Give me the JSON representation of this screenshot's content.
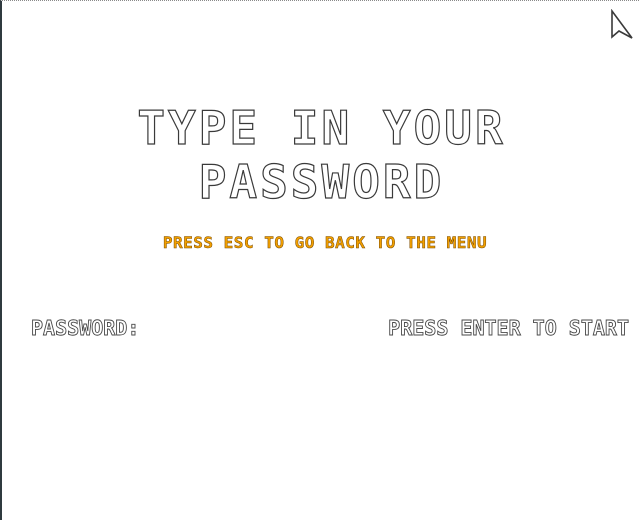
{
  "screen": {
    "title": "TYPE IN YOUR PASSWORD",
    "hint": "PRESS ESC TO GO BACK TO THE MENU",
    "hint_color": "#f2a000"
  },
  "password": {
    "label": "PASSWORD:",
    "value": "",
    "enter_hint": "PRESS ENTER TO START"
  },
  "icons": {
    "cursor": "mouse-pointer-icon"
  }
}
